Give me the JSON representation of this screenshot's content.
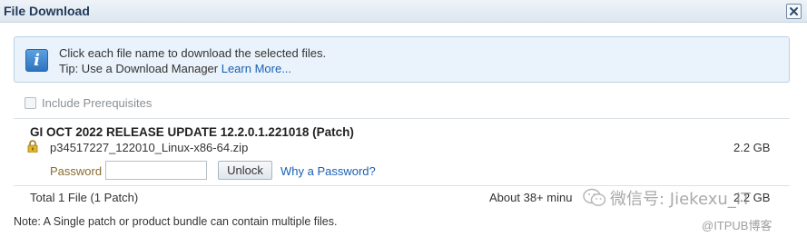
{
  "window": {
    "title": "File Download"
  },
  "info": {
    "line1": "Click each file name to download the selected files.",
    "line2_prefix": "Tip: Use a Download Manager ",
    "learn_more": "Learn More..."
  },
  "options": {
    "include_prerequisites": "Include Prerequisites",
    "include_prerequisites_checked": false
  },
  "patch": {
    "title": "GI OCT 2022 RELEASE UPDATE 12.2.0.1.221018 (Patch)",
    "file_name": "p34517227_122010_Linux-x86-64.zip",
    "file_size": "2.2 GB",
    "password_label": "Password",
    "password_value": "",
    "unlock_label": "Unlock",
    "why_password": "Why a Password?"
  },
  "summary": {
    "total": "Total 1 File (1 Patch)",
    "estimate": "About 38+ minu",
    "total_size": "2.2 GB"
  },
  "note": "Note: A Single patch or product bundle can contain multiple files.",
  "watermark": {
    "text": "微信号: Jiekexu_IT",
    "blog": "@ITPUB博客"
  },
  "colors": {
    "link": "#1a5fb4",
    "info_bg": "#eaf3fb",
    "title": "#1f3a5a"
  }
}
